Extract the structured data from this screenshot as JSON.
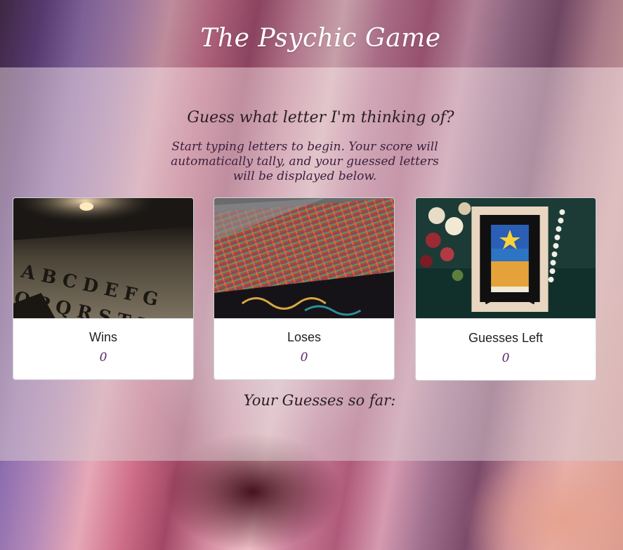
{
  "header": {
    "title": "The Psychic Game"
  },
  "main": {
    "prompt": "Guess what letter I'm thinking of?",
    "instructions": "Start typing letters to begin. Your score will automatically tally, and your guessed letters will be displayed below.",
    "cards": [
      {
        "label": "Wins",
        "value": "0",
        "image": "ouija-board"
      },
      {
        "label": "Loses",
        "value": "0",
        "image": "tarot-card-fan"
      },
      {
        "label": "Guesses Left",
        "value": "0",
        "image": "framed-tarot-card"
      }
    ],
    "guesses_label": "Your Guesses so far:",
    "guesses_value": ""
  },
  "colors": {
    "title_text": "#ffffff",
    "value_text": "#5a2a6a",
    "card_bg": "#ffffff"
  }
}
